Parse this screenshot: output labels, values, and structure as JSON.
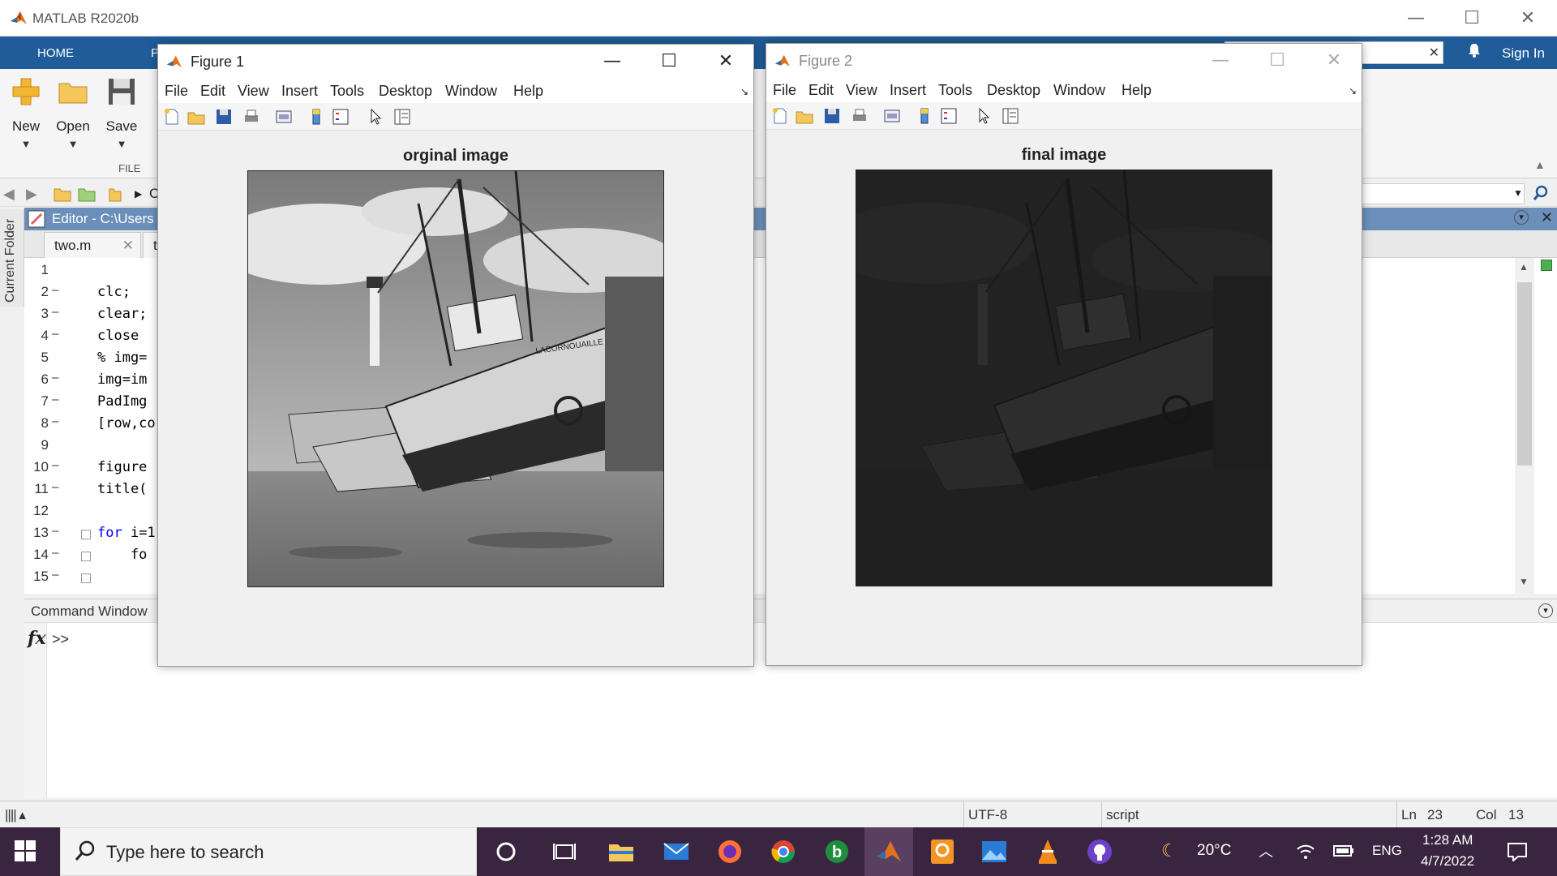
{
  "app": {
    "title": "MATLAB R2020b"
  },
  "window_controls": {
    "minimize": "—",
    "maximize": "☐",
    "close": "✕"
  },
  "ribbon": {
    "tabs": [
      "HOME",
      "P"
    ],
    "sign_in": "Sign In",
    "search_clear": "✕",
    "buttons": {
      "new": "New",
      "open": "Open",
      "save": "Save"
    },
    "group_label": "FILE"
  },
  "address_bar": {
    "path_fragment": "C"
  },
  "side_panel": {
    "label": "Current Folder"
  },
  "editor": {
    "header": "Editor - C:\\Users",
    "tabs": [
      "two.m",
      "th"
    ],
    "tab_close": "✕",
    "lines": [
      {
        "n": "1",
        "dash": "",
        "code": ""
      },
      {
        "n": "2",
        "dash": "—",
        "code": "clc;"
      },
      {
        "n": "3",
        "dash": "—",
        "code": "clear;"
      },
      {
        "n": "4",
        "dash": "—",
        "code": "close "
      },
      {
        "n": "5",
        "dash": "",
        "code": "% img="
      },
      {
        "n": "6",
        "dash": "—",
        "code": "img=im"
      },
      {
        "n": "7",
        "dash": "—",
        "code": "PadImg"
      },
      {
        "n": "8",
        "dash": "—",
        "code": "[row,co"
      },
      {
        "n": "9",
        "dash": "",
        "code": ""
      },
      {
        "n": "10",
        "dash": "—",
        "code": "figure"
      },
      {
        "n": "11",
        "dash": "—",
        "code": "title("
      },
      {
        "n": "12",
        "dash": "",
        "code": ""
      },
      {
        "n": "13",
        "dash": "—",
        "code": "for i=1"
      },
      {
        "n": "14",
        "dash": "—",
        "code": "    fo"
      },
      {
        "n": "15",
        "dash": "—",
        "code": ""
      }
    ]
  },
  "command_window": {
    "title": "Command Window",
    "fx": "fx",
    "prompt": ">>"
  },
  "status_bar": {
    "encoding": "UTF-8",
    "type": "script",
    "ln_label": "Ln",
    "ln": "23",
    "col_label": "Col",
    "col": "13"
  },
  "figure1": {
    "title": "Figure 1",
    "menu": [
      "File",
      "Edit",
      "View",
      "Insert",
      "Tools",
      "Desktop",
      "Window",
      "Help"
    ],
    "axes_title": "orginal image",
    "boat_label": "LACORNOUAILLE"
  },
  "figure2": {
    "title": "Figure 2",
    "menu": [
      "File",
      "Edit",
      "View",
      "Insert",
      "Tools",
      "Desktop",
      "Window",
      "Help"
    ],
    "axes_title": "final image"
  },
  "taskbar": {
    "search_placeholder": "Type here to search",
    "weather": "20°C",
    "language": "ENG",
    "time": "1:28 AM",
    "date": "4/7/2022"
  }
}
